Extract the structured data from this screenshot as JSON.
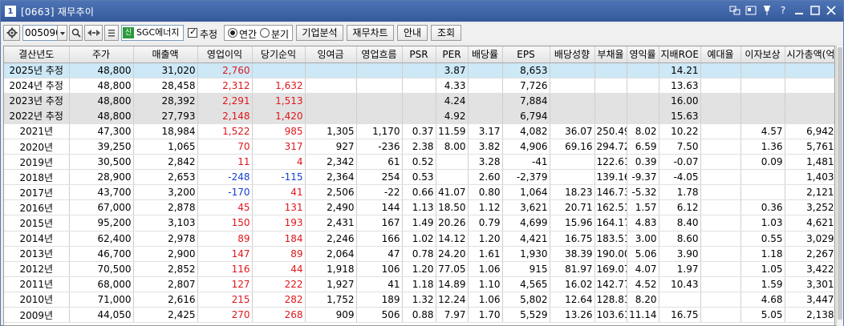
{
  "window": {
    "badge": "1",
    "title": "[0663] 재무추이"
  },
  "toolbar": {
    "code": "005090",
    "name_tag": "신",
    "name": "SGC에너지",
    "estimate_label": "추정",
    "estimate_checked": true,
    "period_annual": "연간",
    "period_quarter": "분기",
    "period_selected": "annual",
    "btn_company": "기업분석",
    "btn_chart": "재무차트",
    "btn_guide": "안내",
    "btn_query": "조회"
  },
  "table": {
    "headers": [
      "결산년도",
      "주가",
      "매출액",
      "영업이익",
      "당기순익",
      "잉여금",
      "영업흐름",
      "PSR",
      "PER",
      "배당률",
      "EPS",
      "배당성향",
      "부채율",
      "영익률",
      "지배ROE",
      "예대율",
      "이자보상",
      "시가총액(억)"
    ],
    "rows": [
      {
        "type": "sel",
        "cells": [
          "2025년 추정",
          "48,800",
          "31,020",
          "2,760",
          "",
          "",
          "",
          "",
          "3.87",
          "",
          "8,653",
          "",
          "",
          "",
          "14.21",
          "",
          "",
          ""
        ],
        "color": {
          "3": "up"
        }
      },
      {
        "type": "normal",
        "cells": [
          "2024년 추정",
          "48,800",
          "28,458",
          "2,312",
          "1,632",
          "",
          "",
          "",
          "4.33",
          "",
          "7,726",
          "",
          "",
          "",
          "13.63",
          "",
          "",
          ""
        ],
        "color": {
          "3": "up",
          "4": "up"
        }
      },
      {
        "type": "est",
        "cells": [
          "2023년 추정",
          "48,800",
          "28,392",
          "2,291",
          "1,513",
          "",
          "",
          "",
          "4.24",
          "",
          "7,884",
          "",
          "",
          "",
          "16.00",
          "",
          "",
          ""
        ],
        "color": {
          "3": "up",
          "4": "up"
        }
      },
      {
        "type": "est",
        "cells": [
          "2022년 추정",
          "48,800",
          "27,793",
          "2,148",
          "1,420",
          "",
          "",
          "",
          "4.92",
          "",
          "6,794",
          "",
          "",
          "",
          "15.63",
          "",
          "",
          ""
        ],
        "color": {
          "3": "up",
          "4": "up"
        }
      },
      {
        "type": "normal",
        "cells": [
          "2021년",
          "47,300",
          "18,984",
          "1,522",
          "985",
          "1,305",
          "1,170",
          "0.37",
          "11.59",
          "3.17",
          "4,082",
          "36.07",
          "250.49",
          "8.02",
          "10.22",
          "",
          "4.57",
          "6,942"
        ],
        "color": {
          "3": "up",
          "4": "up"
        }
      },
      {
        "type": "normal",
        "cells": [
          "2020년",
          "39,250",
          "1,065",
          "70",
          "317",
          "927",
          "-236",
          "2.38",
          "8.00",
          "3.82",
          "4,906",
          "69.16",
          "294.72",
          "6.59",
          "7.50",
          "",
          "1.36",
          "5,761"
        ],
        "color": {
          "3": "up",
          "4": "up"
        }
      },
      {
        "type": "normal",
        "cells": [
          "2019년",
          "30,500",
          "2,842",
          "11",
          "4",
          "2,342",
          "61",
          "0.52",
          "",
          "3.28",
          "-41",
          "",
          "122.61",
          "0.39",
          "-0.07",
          "",
          "0.09",
          "1,481"
        ],
        "color": {
          "3": "up",
          "4": "up"
        }
      },
      {
        "type": "normal",
        "cells": [
          "2018년",
          "28,900",
          "2,653",
          "-248",
          "-115",
          "2,364",
          "254",
          "0.53",
          "",
          "2.60",
          "-2,379",
          "",
          "139.16",
          "-9.37",
          "-4.05",
          "",
          "",
          "1,403"
        ],
        "color": {
          "3": "dn",
          "4": "dn"
        }
      },
      {
        "type": "normal",
        "cells": [
          "2017년",
          "43,700",
          "3,200",
          "-170",
          "41",
          "2,506",
          "-22",
          "0.66",
          "41.07",
          "0.80",
          "1,064",
          "18.23",
          "146.73",
          "-5.32",
          "1.78",
          "",
          "",
          "2,121"
        ],
        "color": {
          "3": "dn",
          "4": "up"
        }
      },
      {
        "type": "normal",
        "cells": [
          "2016년",
          "67,000",
          "2,878",
          "45",
          "131",
          "2,490",
          "144",
          "1.13",
          "18.50",
          "1.12",
          "3,621",
          "20.71",
          "162.51",
          "1.57",
          "6.12",
          "",
          "0.36",
          "3,252"
        ],
        "color": {
          "3": "up",
          "4": "up"
        }
      },
      {
        "type": "normal",
        "cells": [
          "2015년",
          "95,200",
          "3,103",
          "150",
          "193",
          "2,431",
          "167",
          "1.49",
          "20.26",
          "0.79",
          "4,699",
          "15.96",
          "164.17",
          "4.83",
          "8.40",
          "",
          "1.03",
          "4,621"
        ],
        "color": {
          "3": "up",
          "4": "up"
        }
      },
      {
        "type": "normal",
        "cells": [
          "2014년",
          "62,400",
          "2,978",
          "89",
          "184",
          "2,246",
          "166",
          "1.02",
          "14.12",
          "1.20",
          "4,421",
          "16.75",
          "183.51",
          "3.00",
          "8.60",
          "",
          "0.55",
          "3,029"
        ],
        "color": {
          "3": "up",
          "4": "up"
        }
      },
      {
        "type": "normal",
        "cells": [
          "2013년",
          "46,700",
          "2,900",
          "147",
          "89",
          "2,064",
          "47",
          "0.78",
          "24.20",
          "1.61",
          "1,930",
          "38.39",
          "190.00",
          "5.06",
          "3.90",
          "",
          "1.18",
          "2,267"
        ],
        "color": {
          "3": "up",
          "4": "up"
        }
      },
      {
        "type": "normal",
        "cells": [
          "2012년",
          "70,500",
          "2,852",
          "116",
          "44",
          "1,918",
          "106",
          "1.20",
          "77.05",
          "1.06",
          "915",
          "81.97",
          "169.07",
          "4.07",
          "1.97",
          "",
          "1.05",
          "3,422"
        ],
        "color": {
          "3": "up",
          "4": "up"
        }
      },
      {
        "type": "normal",
        "cells": [
          "2011년",
          "68,000",
          "2,807",
          "127",
          "222",
          "1,927",
          "41",
          "1.18",
          "14.89",
          "1.10",
          "4,565",
          "16.02",
          "142.77",
          "4.52",
          "10.43",
          "",
          "1.59",
          "3,301"
        ],
        "color": {
          "3": "up",
          "4": "up"
        }
      },
      {
        "type": "normal",
        "cells": [
          "2010년",
          "71,000",
          "2,616",
          "215",
          "282",
          "1,752",
          "189",
          "1.32",
          "12.24",
          "1.06",
          "5,802",
          "12.64",
          "128.81",
          "8.20",
          "",
          "",
          "4.68",
          "3,447"
        ],
        "color": {
          "3": "up",
          "4": "up"
        }
      },
      {
        "type": "normal",
        "cells": [
          "2009년",
          "44,050",
          "2,425",
          "270",
          "268",
          "909",
          "506",
          "0.88",
          "7.97",
          "1.70",
          "5,529",
          "13.26",
          "103.61",
          "11.14",
          "16.75",
          "",
          "5.05",
          "2,138"
        ],
        "color": {
          "3": "up",
          "4": "up"
        }
      }
    ]
  }
}
